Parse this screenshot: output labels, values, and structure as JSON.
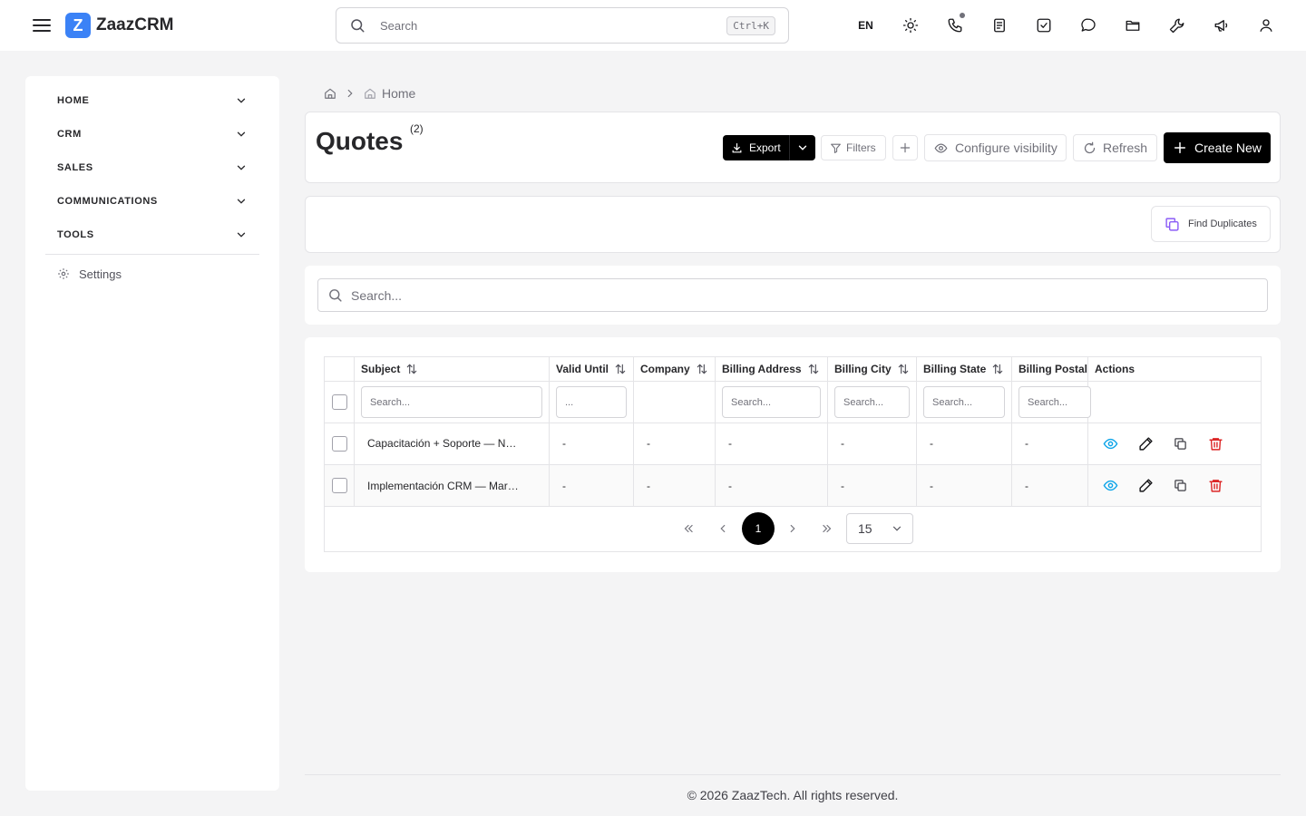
{
  "app": {
    "logo_letter": "Z",
    "name": "ZaazCRM",
    "brand_color": "#3b82f6"
  },
  "topbar": {
    "search_placeholder": "Search",
    "search_shortcut": "Ctrl+K",
    "language": "EN",
    "icons": [
      "sun-icon",
      "phone-icon",
      "notes-icon",
      "tasks-icon",
      "chat-icon",
      "folder-icon",
      "tools-icon",
      "megaphone-icon",
      "user-icon"
    ]
  },
  "sidebar": {
    "items": [
      {
        "label": "HOME"
      },
      {
        "label": "CRM"
      },
      {
        "label": "SALES"
      },
      {
        "label": "COMMUNICATIONS"
      },
      {
        "label": "TOOLS"
      }
    ],
    "settings_label": "Settings"
  },
  "breadcrumb": {
    "current": "Home"
  },
  "page": {
    "title": "Quotes",
    "count": "(2)"
  },
  "toolbar": {
    "export_label": "Export",
    "filters_label": "Filters",
    "configure_label": "Configure visibility",
    "refresh_label": "Refresh",
    "create_label": "Create New"
  },
  "duplicates": {
    "label": "Find Duplicates"
  },
  "search": {
    "placeholder": "Search..."
  },
  "table": {
    "columns": [
      "Subject",
      "Valid Until",
      "Company",
      "Billing Address",
      "Billing City",
      "Billing State",
      "Billing Postal",
      "Actions"
    ],
    "filter_placeholders": {
      "subject": "Search...",
      "valid_until": "...",
      "billing_address": "Search...",
      "billing_city": "Search...",
      "billing_state": "Search...",
      "billing_postal": "Search..."
    },
    "rows": [
      {
        "subject": "Capacitación + Soporte — N…",
        "valid_until": "-",
        "company": "-",
        "billing_address": "-",
        "billing_city": "-",
        "billing_state": "-",
        "billing_postal": "-"
      },
      {
        "subject": "Implementación CRM — Mar…",
        "valid_until": "-",
        "company": "-",
        "billing_address": "-",
        "billing_city": "-",
        "billing_state": "-",
        "billing_postal": "-"
      }
    ],
    "action_colors": {
      "view": "#0ea5e9",
      "edit": "#18181b",
      "copy": "#3f3f46",
      "delete": "#dc2626"
    }
  },
  "pagination": {
    "current_page": "1",
    "page_size": "15"
  },
  "footer": {
    "text": "© 2026 ZaazTech. All rights reserved."
  }
}
